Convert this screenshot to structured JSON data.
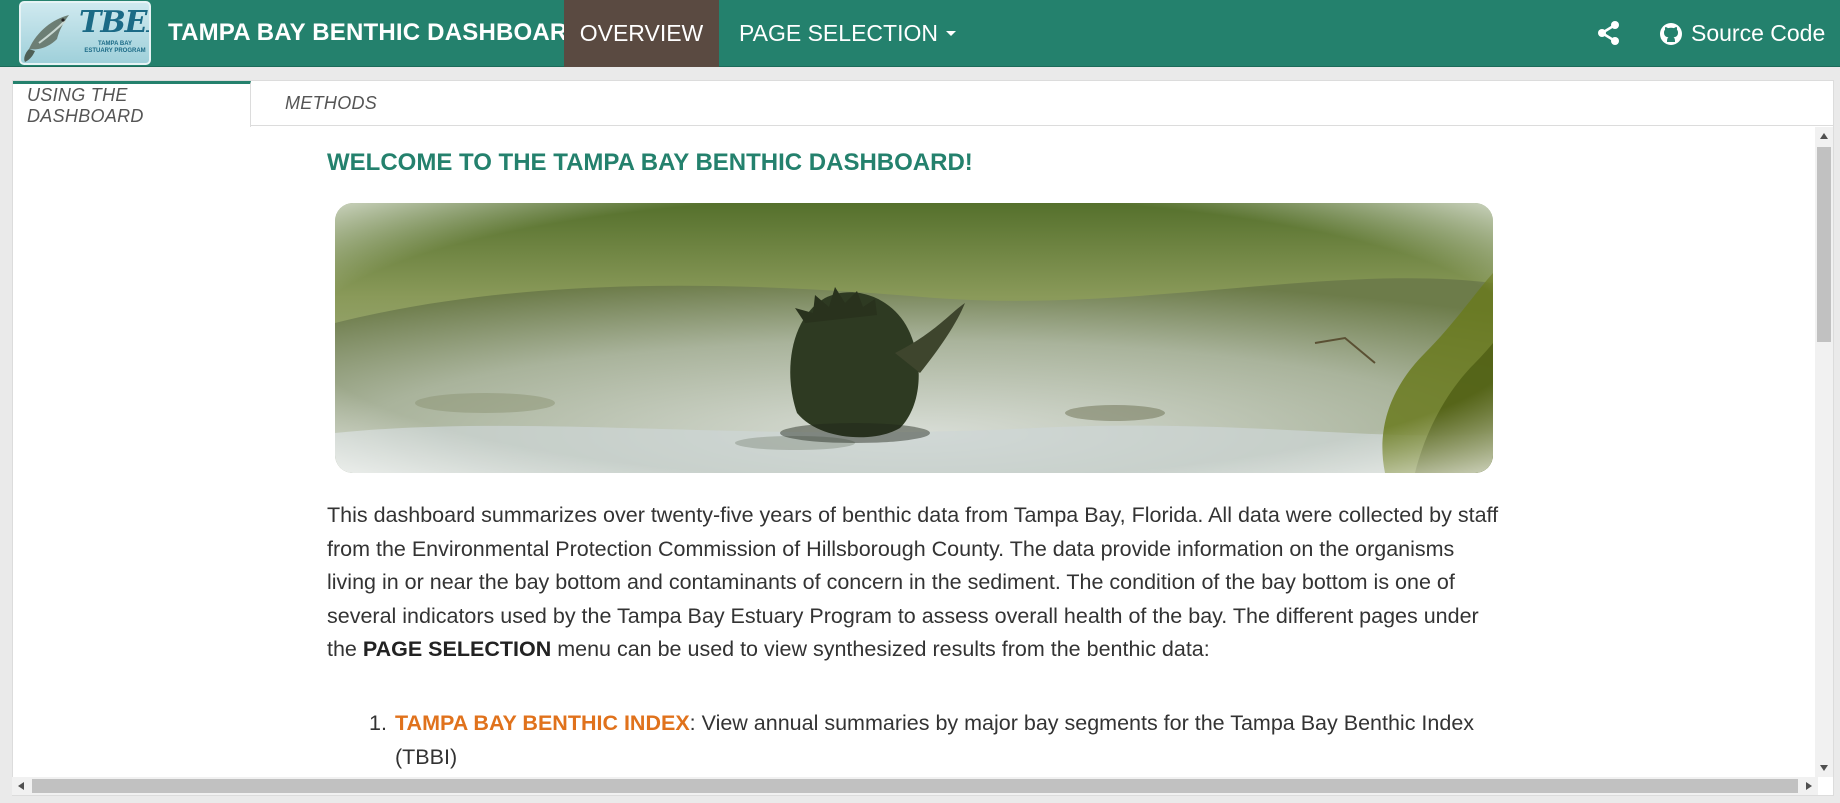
{
  "navbar": {
    "logo_text": "TBEP",
    "logo_sub": "TAMPA BAY ESTUARY PROGRAM",
    "brand": "TAMPA BAY BENTHIC DASHBOARD",
    "overview": "OVERVIEW",
    "page_selection": "PAGE SELECTION",
    "source_code": "Source Code",
    "icons": {
      "share": "share-icon",
      "github": "github-icon",
      "caret": "caret-down-icon"
    }
  },
  "tabs": [
    {
      "label": "USING THE DASHBOARD",
      "active": true
    },
    {
      "label": "METHODS",
      "active": false
    }
  ],
  "content": {
    "title": "WELCOME TO THE TAMPA BAY BENTHIC DASHBOARD!",
    "para_1": "This dashboard summarizes over twenty-five years of benthic data from Tampa Bay, Florida. All data were collected by staff from the Environmental Protection Commission of Hillsborough County. The data provide information on the organisms living in or near the bay bottom and contaminants of concern in the sediment. The condition of the bay bottom is one of several indicators used by the Tampa Bay Estuary Program to assess overall health of the bay. The different pages under the ",
    "para_bold": "PAGE SELECTION",
    "para_2": " menu can be used to view synthesized results from the benthic data:",
    "list": [
      {
        "num": "1.",
        "link": "TAMPA BAY BENTHIC INDEX",
        "text": ": View annual summaries by major bay segments for the Tampa Bay Benthic Index (TBBI)"
      }
    ]
  },
  "colors": {
    "navbar": "#24816d",
    "active_nav": "#5a4a41",
    "title": "#24816d",
    "link": "#e0721c"
  }
}
